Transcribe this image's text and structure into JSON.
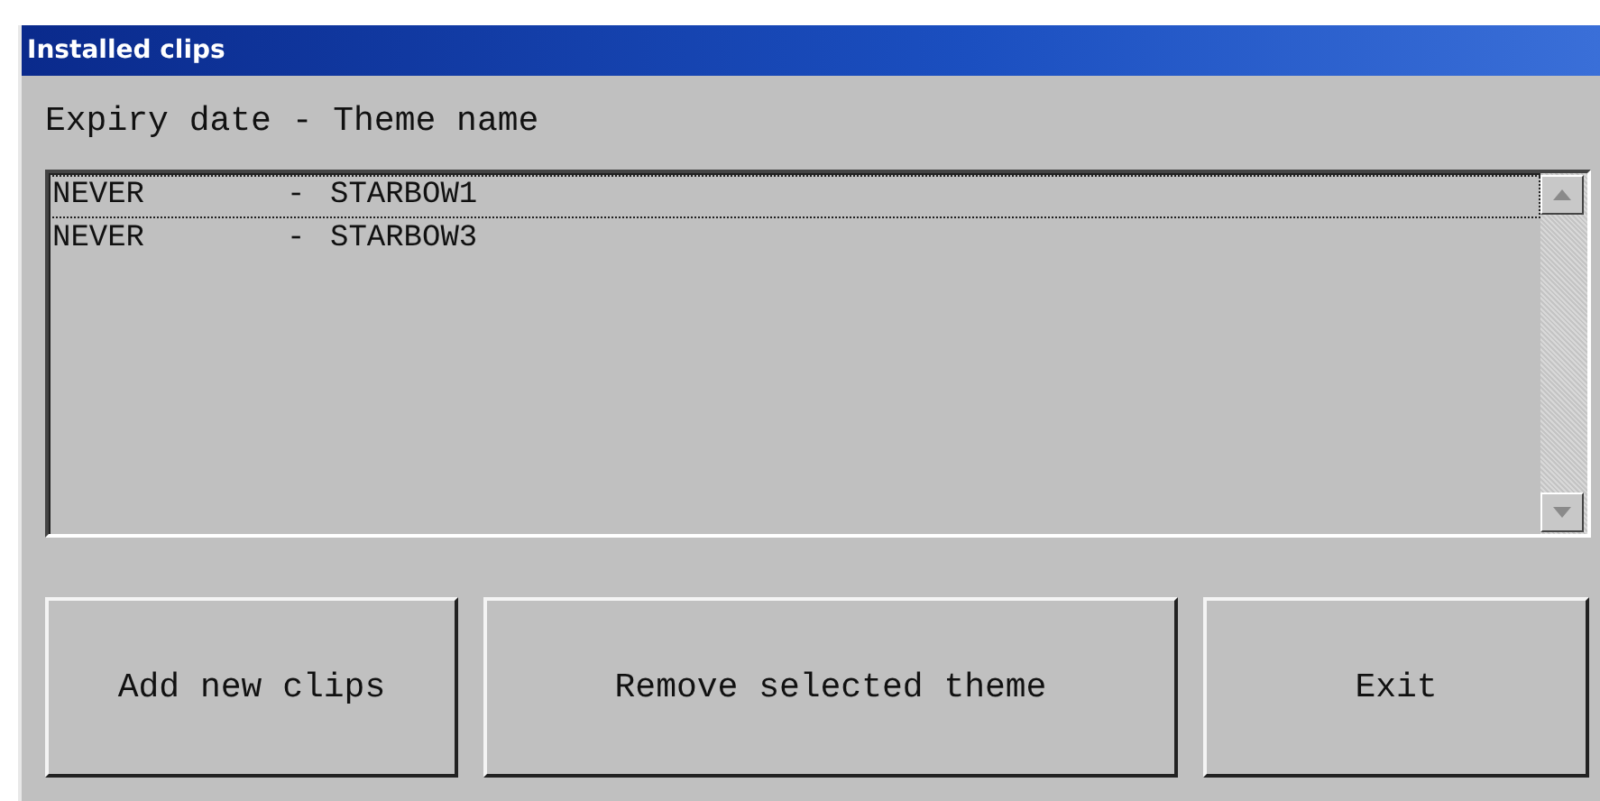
{
  "window": {
    "title": "Installed clips"
  },
  "list": {
    "header": "Expiry date - Theme name",
    "rows": [
      {
        "expiry": "NEVER",
        "separator": "-",
        "theme": "STARBOW1",
        "focused": true
      },
      {
        "expiry": "NEVER",
        "separator": "-",
        "theme": "STARBOW3",
        "focused": false
      }
    ]
  },
  "buttons": [
    {
      "label": "Add new clips"
    },
    {
      "label": "Remove selected theme"
    },
    {
      "label": "Exit"
    }
  ]
}
